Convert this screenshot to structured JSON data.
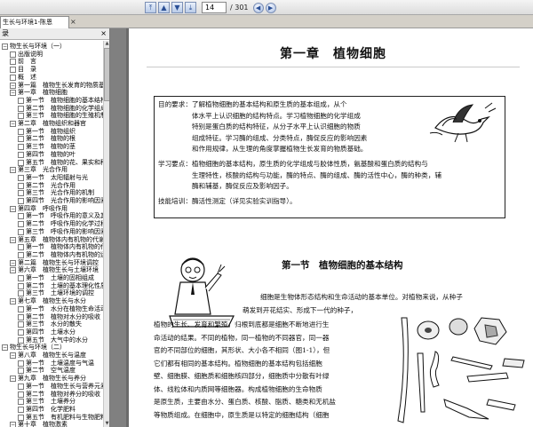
{
  "toolbar": {
    "nav_first": "first-page",
    "nav_prev": "prev-page",
    "nav_next": "next-page",
    "nav_last": "last-page",
    "page_current": "14",
    "page_total": "/ 301"
  },
  "tab": {
    "title": "生长与环境1-陈恩",
    "close": "×"
  },
  "sidebar": {
    "header": "录",
    "close": "×",
    "items": [
      {
        "label": "物生长与环境（一）",
        "indent": 0,
        "box": "−"
      },
      {
        "label": "出版说明",
        "indent": 1,
        "box": ""
      },
      {
        "label": "前　言",
        "indent": 1,
        "box": ""
      },
      {
        "label": "目　录",
        "indent": 1,
        "box": ""
      },
      {
        "label": "概　述",
        "indent": 1,
        "box": ""
      },
      {
        "label": "第一篇　植物生长发育的物质基础",
        "indent": 1,
        "box": "−"
      },
      {
        "label": "第一章　植物细胞",
        "indent": 1,
        "box": "−"
      },
      {
        "label": "第一节　植物细胞的基本结构",
        "indent": 2,
        "box": ""
      },
      {
        "label": "第二节　植物细胞的化学组成",
        "indent": 2,
        "box": ""
      },
      {
        "label": "第三节　植物细胞的生殖机制",
        "indent": 2,
        "box": ""
      },
      {
        "label": "第二章　植物组织和器官",
        "indent": 1,
        "box": "−"
      },
      {
        "label": "第一节　植物组织",
        "indent": 2,
        "box": ""
      },
      {
        "label": "第二节　植物的根",
        "indent": 2,
        "box": ""
      },
      {
        "label": "第三节　植物的茎",
        "indent": 2,
        "box": ""
      },
      {
        "label": "第四节　植物的叶",
        "indent": 2,
        "box": ""
      },
      {
        "label": "第五节　植物的花、果实和种子",
        "indent": 2,
        "box": ""
      },
      {
        "label": "第三章　光合作用",
        "indent": 1,
        "box": "−"
      },
      {
        "label": "第一节　太阳辐射与光",
        "indent": 2,
        "box": ""
      },
      {
        "label": "第二节　光合作用",
        "indent": 2,
        "box": ""
      },
      {
        "label": "第三节　光合作用的机制",
        "indent": 2,
        "box": ""
      },
      {
        "label": "第四节　光合作用的影响因素",
        "indent": 2,
        "box": ""
      },
      {
        "label": "第四章　呼吸作用",
        "indent": 1,
        "box": "−"
      },
      {
        "label": "第一节　呼吸作用的意义及其类型",
        "indent": 2,
        "box": ""
      },
      {
        "label": "第二节　呼吸作用的化学过程",
        "indent": 2,
        "box": ""
      },
      {
        "label": "第三节　呼吸作用的影响因素",
        "indent": 2,
        "box": ""
      },
      {
        "label": "第五章　植物体内有机物的代谢与运输",
        "indent": 1,
        "box": "−"
      },
      {
        "label": "第一节　植物体内有机物的代谢",
        "indent": 2,
        "box": ""
      },
      {
        "label": "第二节　植物体内有机物的运输",
        "indent": 2,
        "box": ""
      },
      {
        "label": "第二篇　植物生长与环境调控",
        "indent": 1,
        "box": "−"
      },
      {
        "label": "第六章　植物生长与土壤环境",
        "indent": 1,
        "box": "−"
      },
      {
        "label": "第一节　土壤的固相组成",
        "indent": 2,
        "box": ""
      },
      {
        "label": "第二节　土壤的基本理化性质",
        "indent": 2,
        "box": ""
      },
      {
        "label": "第三节　土壤环境的调控",
        "indent": 2,
        "box": ""
      },
      {
        "label": "第七章　植物生长与水分",
        "indent": 1,
        "box": "−"
      },
      {
        "label": "第一节　水分在植物生命活动中的作用",
        "indent": 2,
        "box": ""
      },
      {
        "label": "第二节　植物对水分的吸收",
        "indent": 2,
        "box": ""
      },
      {
        "label": "第三节　水分的散失",
        "indent": 2,
        "box": ""
      },
      {
        "label": "第四节　土壤水分",
        "indent": 2,
        "box": ""
      },
      {
        "label": "第五节　大气中的水分",
        "indent": 2,
        "box": ""
      },
      {
        "label": "物生长与环境（二）",
        "indent": 0,
        "box": "−"
      },
      {
        "label": "第八章　植物生长与温度",
        "indent": 1,
        "box": "−"
      },
      {
        "label": "第一节　土壤温度与气温",
        "indent": 2,
        "box": ""
      },
      {
        "label": "第二节　空气温度",
        "indent": 2,
        "box": ""
      },
      {
        "label": "第九章　植物生长与养分",
        "indent": 1,
        "box": "−"
      },
      {
        "label": "第一节　植物生长与营养元素",
        "indent": 2,
        "box": ""
      },
      {
        "label": "第二节　植物对养分的吸收",
        "indent": 2,
        "box": ""
      },
      {
        "label": "第三节　土壤养分",
        "indent": 2,
        "box": ""
      },
      {
        "label": "第四节　化学肥料",
        "indent": 2,
        "box": ""
      },
      {
        "label": "第五节　有机肥料与生物肥料",
        "indent": 2,
        "box": ""
      },
      {
        "label": "第十章　植物激素",
        "indent": 1,
        "box": "−"
      }
    ]
  },
  "page": {
    "chapter_title": "第一章　植物细胞",
    "requirements": [
      "目的要求：了解植物细胞的基本结构和原生质的基本组成，从个",
      "　　　　　体水平上认识细胞的结构特点。学习植物细胞的化学组成",
      "　　　　　特别是蛋白质的结构特征，从分子水平上认识细胞的物质",
      "　　　　　组成特征。学习酶的组成、分类特点，酶促反应的影响因素",
      "　　　　　和作用规律，从生理的角度掌握植物生长发育的物质基础。",
      "学习要点：植物细胞的基本结构，原生质的化学组成与胶体性质，氨基酸和蛋白质的结构与",
      "　　　　　生理特性，核酸的结构与功能，酶的特点、酶的组成、酶的活性中心，酶的种类，辅",
      "　　　　　酶和辅基，酶促反应及影响因子。",
      "技能培训：酶活性测定（详见实验实训指导）。"
    ],
    "section_title": "第一节　植物细胞的基本结构",
    "body_right": [
      "细胞是生物体形态结构和生命活动的基本单位。对植物来说，从种子",
      "萌发到开花结实、形成下一代的种子，"
    ],
    "body": [
      "植物的生长、发育和繁殖，归根到底都是细胞不断地进行生",
      "命活动的结果。不同的植物，同一植物的不同器官，同一器",
      "官的不同部位的细胞，其形状、大小各不相同（图1-1），但",
      "它们都有相同的基本结构。植物细胞的基本结构包括细胞",
      "壁、细胞膜、细胞质和细胞核四部分，细胞质中分散有叶绿",
      "体、线粒体和内质网等细胞器。构成植物细胞的生命物质",
      "是原生质，主要由水分、蛋白质、核酸、脂质、糖类和无机盐",
      "等物质组成。在细胞中，原生质是以特定的细胞结构（细胞"
    ]
  },
  "icons": {
    "bird": "cartoon-bird-icon",
    "professor": "cartoon-professor-illustration",
    "cells": "plant-cell-shapes-figure"
  }
}
